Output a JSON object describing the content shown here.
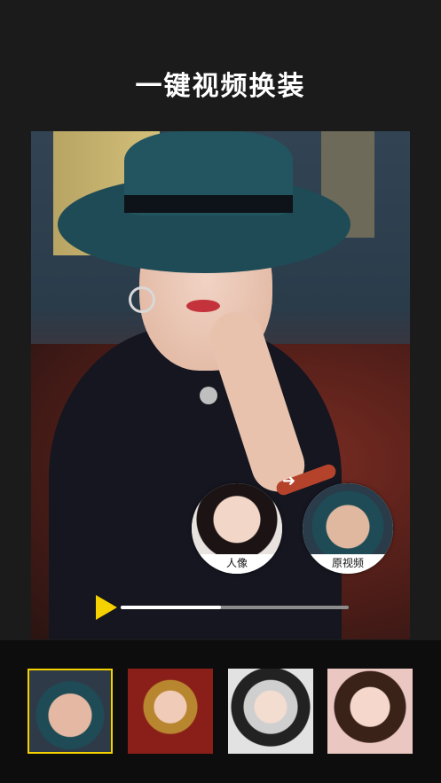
{
  "header": {
    "title": "一键视频换装"
  },
  "player": {
    "progress": 0.44,
    "accent_color": "#f5d100",
    "play_icon": "play-icon"
  },
  "bubbles": [
    {
      "label": "人像"
    },
    {
      "label": "原视频"
    }
  ],
  "thumbnails": [
    {
      "name": "woman-teal-hat",
      "selected": true
    },
    {
      "name": "bride-red-headdress",
      "selected": false
    },
    {
      "name": "silver-headdress-costume",
      "selected": false
    },
    {
      "name": "woman-portrait",
      "selected": false
    }
  ]
}
